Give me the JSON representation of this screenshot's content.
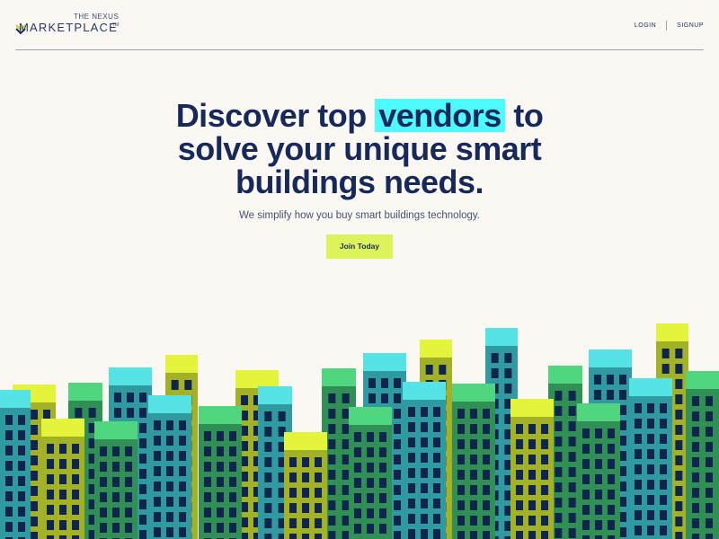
{
  "brand": {
    "the": "THE NEXUS",
    "word": "MARKETPLACE",
    "tm": "TM"
  },
  "nav": {
    "login": "LOGIN",
    "signup": "SIGNUP"
  },
  "hero": {
    "headline_pre": "Discover top",
    "headline_highlight": "vendors",
    "headline_post_line1": "to",
    "headline_line2": "solve your unique smart",
    "headline_line3": "buildings needs.",
    "subtitle": "We simplify how you buy smart buildings technology.",
    "cta_label": "Join Today"
  },
  "colors": {
    "background": "#fbf8f3",
    "navy": "#16295a",
    "highlight": "#4dfaff",
    "cta": "#dcf35a",
    "building_cyan": "#55e3e6",
    "building_green": "#4fd67f",
    "building_yellow": "#e3f43a",
    "building_teal": "#2f9aa0",
    "building_olive": "#a3b127",
    "window": "#10254d"
  },
  "icons": {
    "logo": "nexus-chevron-logo-icon"
  }
}
